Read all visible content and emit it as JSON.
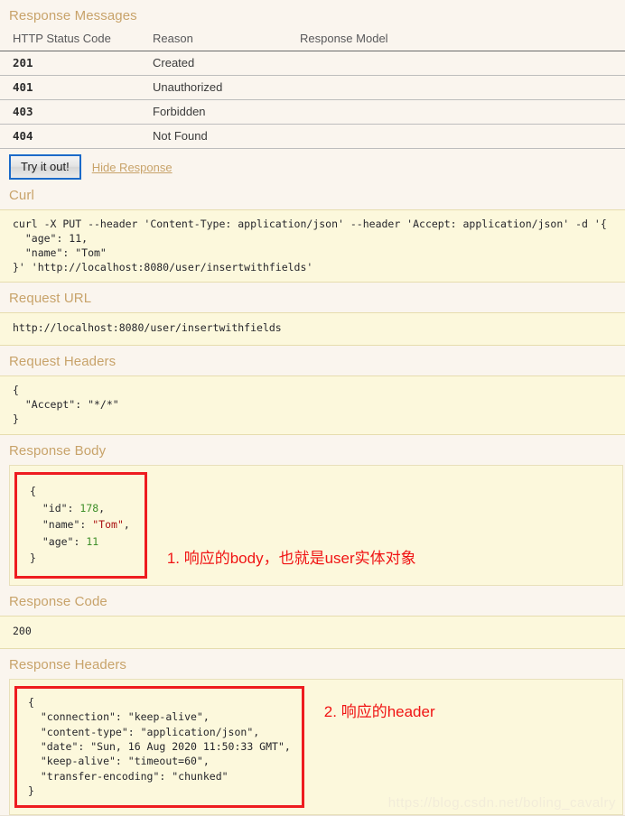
{
  "response_messages": {
    "title": "Response Messages",
    "columns": [
      "HTTP Status Code",
      "Reason",
      "Response Model"
    ],
    "rows": [
      {
        "code": "201",
        "reason": "Created",
        "model": ""
      },
      {
        "code": "401",
        "reason": "Unauthorized",
        "model": ""
      },
      {
        "code": "403",
        "reason": "Forbidden",
        "model": ""
      },
      {
        "code": "404",
        "reason": "Not Found",
        "model": ""
      }
    ]
  },
  "actions": {
    "try_it_out_label": "Try it out!",
    "hide_response_label": "Hide Response"
  },
  "curl": {
    "title": "Curl",
    "command": "curl -X PUT --header 'Content-Type: application/json' --header 'Accept: application/json' -d '{\n  \"age\": 11,\n  \"name\": \"Tom\"\n}' 'http://localhost:8080/user/insertwithfields'"
  },
  "request_url": {
    "title": "Request URL",
    "url": "http://localhost:8080/user/insertwithfields"
  },
  "request_headers": {
    "title": "Request Headers",
    "body": "{\n  \"Accept\": \"*/*\"\n}"
  },
  "response_body": {
    "title": "Response Body",
    "lines": [
      {
        "text": "{",
        "type": "plain"
      },
      {
        "key": "  \"id\": ",
        "value": "178",
        "value_type": "num",
        "suffix": ","
      },
      {
        "key": "  \"name\": ",
        "value": "\"Tom\"",
        "value_type": "str",
        "suffix": ","
      },
      {
        "key": "  \"age\": ",
        "value": "11",
        "value_type": "num",
        "suffix": ""
      },
      {
        "text": "}",
        "type": "plain"
      }
    ],
    "annotation": "1. 响应的body，也就是user实体对象"
  },
  "response_code": {
    "title": "Response Code",
    "value": "200"
  },
  "response_headers": {
    "title": "Response Headers",
    "body": "{\n  \"connection\": \"keep-alive\",\n  \"content-type\": \"application/json\",\n  \"date\": \"Sun, 16 Aug 2020 11:50:33 GMT\",\n  \"keep-alive\": \"timeout=60\",\n  \"transfer-encoding\": \"chunked\"\n}",
    "annotation": "2. 响应的header"
  },
  "watermark": "https://blog.csdn.net/boling_cavalry",
  "colors": {
    "page_background": "#faf5ee",
    "code_background": "#fcf8dc",
    "section_heading": "#c8a36a",
    "annotation_red": "#f01414",
    "redbox_border": "#ee1c20",
    "button_border": "#1b6ac9",
    "json_number": "#3f8f29",
    "json_string": "#aa1111"
  }
}
